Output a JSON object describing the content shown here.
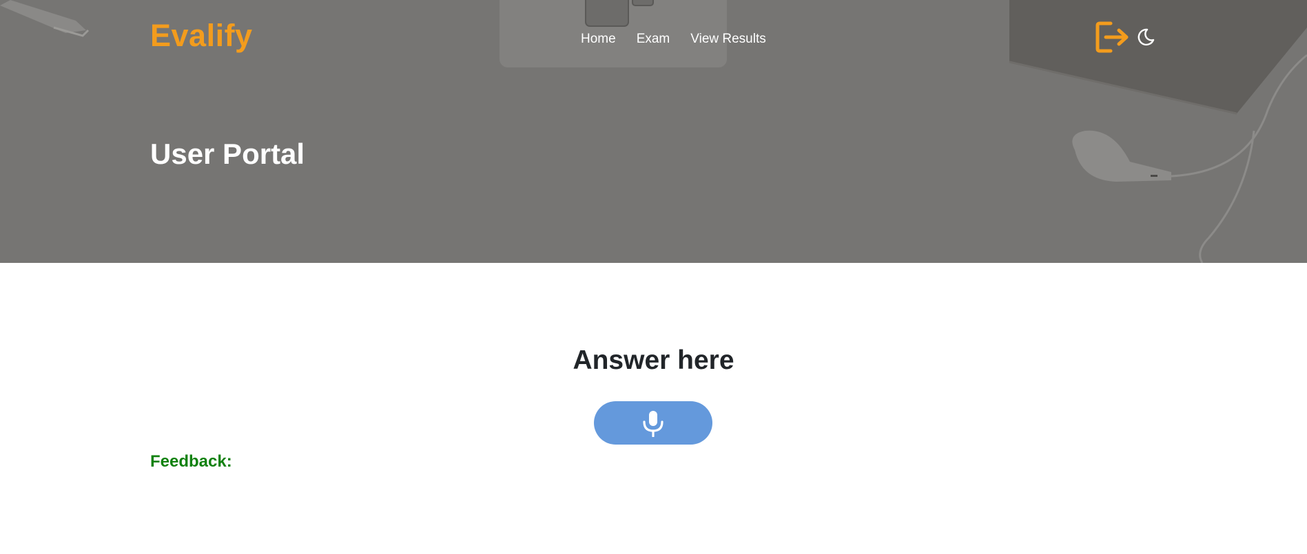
{
  "brand": {
    "name": "Evalify"
  },
  "nav": {
    "items": [
      {
        "label": "Home"
      },
      {
        "label": "Exam"
      },
      {
        "label": "View Results"
      }
    ]
  },
  "actions": {
    "logout_icon": "logout-icon",
    "theme_icon": "moon-icon"
  },
  "hero": {
    "title": "User Portal"
  },
  "main": {
    "heading": "Answer here",
    "record_icon": "microphone-icon",
    "feedback_label": "Feedback:"
  },
  "colors": {
    "brand": "#f39c1d",
    "hero_overlay": "#767573",
    "mic_button": "#6499dc",
    "feedback": "#11810f",
    "heading": "#212529"
  }
}
